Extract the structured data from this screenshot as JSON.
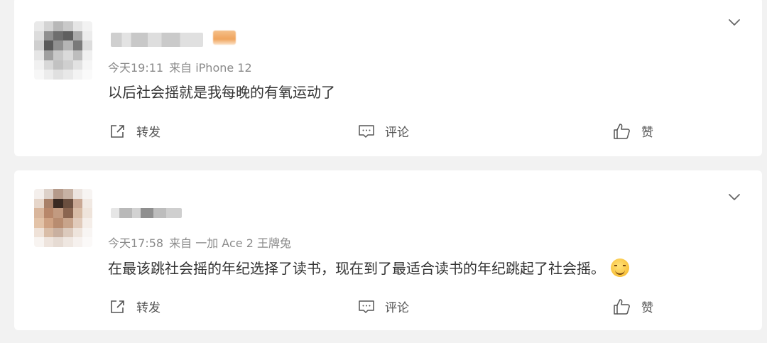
{
  "comments": [
    {
      "time": "今天19:11",
      "source": "来自 iPhone 12",
      "text": "以后社会摇就是我每晚的有氧运动了",
      "actions": {
        "repost": "转发",
        "comment": "评论",
        "like": "赞"
      }
    },
    {
      "time": "今天17:58",
      "source": "来自 一加 Ace 2 王牌兔",
      "text": "在最该跳社会摇的年纪选择了读书，现在到了最适合读书的年纪跳起了社会摇。",
      "actions": {
        "repost": "转发",
        "comment": "评论",
        "like": "赞"
      }
    }
  ],
  "icons": {
    "more": "chevron-down-icon",
    "repost": "share-icon",
    "comment": "comment-icon",
    "like": "thumbs-up-icon",
    "emoji": "smirk-emoji-icon"
  },
  "colors": {
    "page_bg": "#f2f2f2",
    "card_bg": "#ffffff",
    "text": "#333333",
    "meta": "#8a8a8a",
    "icon": "#555555"
  }
}
